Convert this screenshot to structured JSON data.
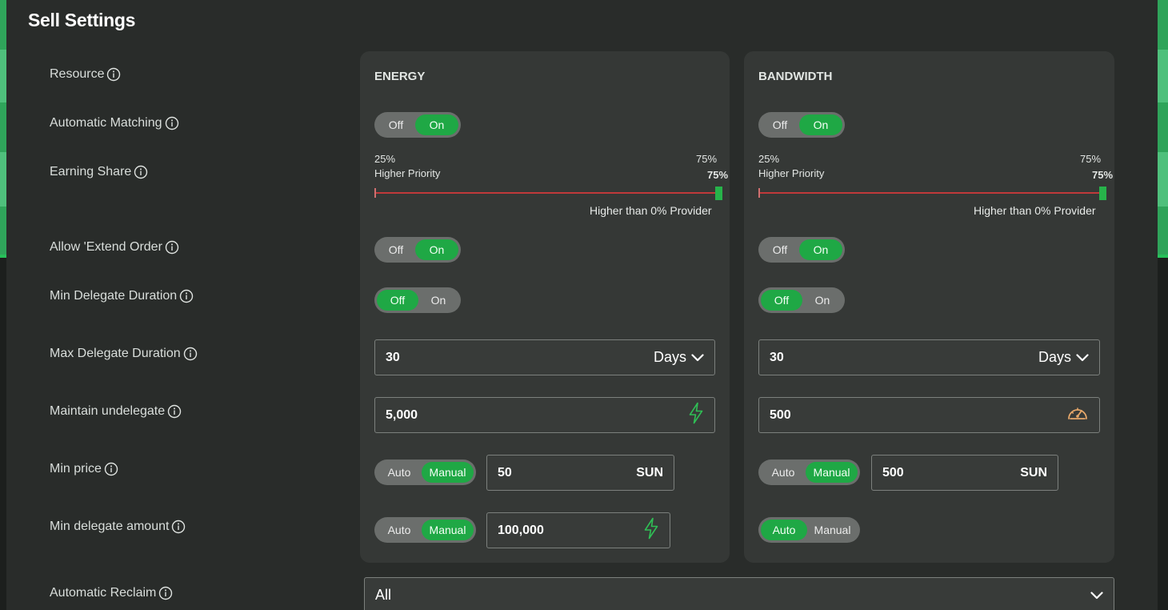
{
  "page": {
    "title": "Sell Settings"
  },
  "labels": {
    "resource": "Resource",
    "automatic_matching": "Automatic Matching",
    "earning_share": "Earning Share",
    "allow_extend_order": "Allow 'Extend Order",
    "min_delegate_duration": "Min Delegate Duration",
    "max_delegate_duration": "Max Delegate Duration",
    "maintain_undelegate": "Maintain undelegate",
    "min_price": "Min price",
    "min_delegate_amount": "Min delegate amount",
    "automatic_reclaim": "Automatic Reclaim"
  },
  "energy": {
    "title": "ENERGY",
    "automatic_matching": {
      "off": "Off",
      "on": "On",
      "selected": "On"
    },
    "earning_share": {
      "left_pct": "25%",
      "left_caption": "Higher Priority",
      "right_pct": "75%",
      "thumb_value": "75%",
      "value_fraction": 1.0,
      "sub_caption": "Higher than 0% Provider"
    },
    "allow_extend_order": {
      "off": "Off",
      "on": "On",
      "selected": "On"
    },
    "min_delegate_duration": {
      "off": "Off",
      "on": "On",
      "selected": "Off"
    },
    "max_delegate_duration": {
      "value": "30",
      "unit": "Days"
    },
    "maintain_undelegate": {
      "value": "5,000",
      "icon": "lightning-icon"
    },
    "min_price": {
      "auto": "Auto",
      "manual": "Manual",
      "selected": "Manual",
      "value": "50",
      "unit": "SUN"
    },
    "min_delegate_amount": {
      "auto": "Auto",
      "manual": "Manual",
      "selected": "Manual",
      "value": "100,000",
      "icon": "lightning-icon"
    }
  },
  "bandwidth": {
    "title": "BANDWIDTH",
    "automatic_matching": {
      "off": "Off",
      "on": "On",
      "selected": "On"
    },
    "earning_share": {
      "left_pct": "25%",
      "left_caption": "Higher Priority",
      "right_pct": "75%",
      "thumb_value": "75%",
      "value_fraction": 1.0,
      "sub_caption": "Higher than 0% Provider"
    },
    "allow_extend_order": {
      "off": "Off",
      "on": "On",
      "selected": "On"
    },
    "min_delegate_duration": {
      "off": "Off",
      "on": "On",
      "selected": "Off"
    },
    "max_delegate_duration": {
      "value": "30",
      "unit": "Days"
    },
    "maintain_undelegate": {
      "value": "500",
      "icon": "speedometer-icon"
    },
    "min_price": {
      "auto": "Auto",
      "manual": "Manual",
      "selected": "Manual",
      "value": "500",
      "unit": "SUN"
    },
    "min_delegate_amount": {
      "auto": "Auto",
      "manual": "Manual",
      "selected": "Auto"
    }
  },
  "automatic_reclaim": {
    "value": "All"
  },
  "colors": {
    "accent": "#1fa845",
    "track": "#c0393a",
    "speedometer": "#e6a86a",
    "lightning": "#2fbf55"
  }
}
